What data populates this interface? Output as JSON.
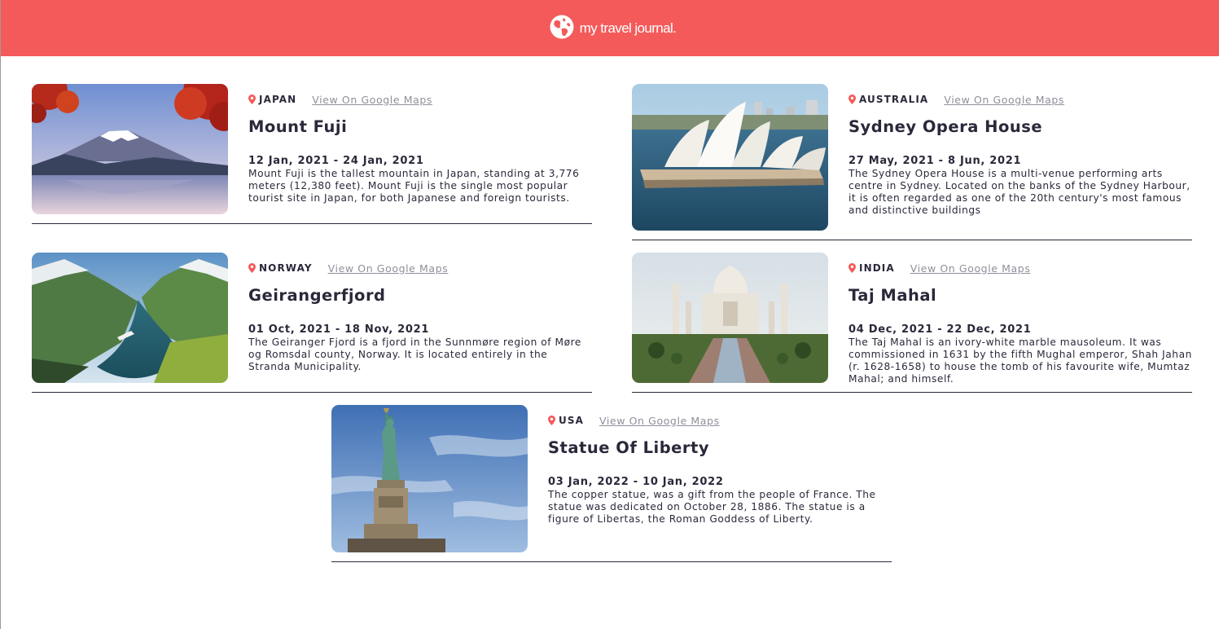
{
  "header": {
    "title": "my travel journal."
  },
  "entries": [
    {
      "country": "JAPAN",
      "maps_label": "View On Google Maps",
      "title": "Mount Fuji",
      "dates": "12 Jan, 2021 - 24 Jan, 2021",
      "description": "Mount Fuji is the tallest mountain in Japan, standing at 3,776 meters (12,380 feet). Mount Fuji is the single most popular tourist site in Japan, for both Japanese and foreign tourists.",
      "photo": "mount-fuji-photo"
    },
    {
      "country": "AUSTRALIA",
      "maps_label": "View On Google Maps",
      "title": "Sydney Opera House",
      "dates": "27 May, 2021 - 8 Jun, 2021",
      "description": "The Sydney Opera House is a multi-venue performing arts centre in Sydney. Located on the banks of the Sydney Harbour, it is often regarded as one of the 20th century's most famous and distinctive buildings",
      "photo": "sydney-opera-house-photo"
    },
    {
      "country": "NORWAY",
      "maps_label": "View On Google Maps",
      "title": "Geirangerfjord",
      "dates": "01 Oct, 2021 - 18 Nov, 2021",
      "description": "The Geiranger Fjord is a fjord in the Sunnmøre region of Møre og Romsdal county, Norway. It is located entirely in the Stranda Municipality.",
      "photo": "geirangerfjord-photo"
    },
    {
      "country": "INDIA",
      "maps_label": "View On Google Maps",
      "title": "Taj Mahal",
      "dates": "04 Dec, 2021 - 22 Dec, 2021",
      "description": "The Taj Mahal is an ivory-white marble mausoleum. It was commissioned in 1631 by the fifth Mughal emperor, Shah Jahan (r. 1628-1658) to house the tomb of his favourite wife, Mumtaz Mahal; and himself.",
      "photo": "taj-mahal-photo"
    },
    {
      "country": "USA",
      "maps_label": "View On Google Maps",
      "title": "Statue Of Liberty",
      "dates": "03 Jan, 2022 - 10 Jan, 2022",
      "description": "The copper statue, was a gift from the people of France. The statue was dedicated on October 28, 1886. The statue is a figure of Libertas, the Roman Goddess of Liberty.",
      "photo": "statue-of-liberty-photo"
    }
  ],
  "colors": {
    "brand": "#f55a5a",
    "text": "#2b283a",
    "link": "#918e9b"
  },
  "icons": {
    "logo": "globe-icon",
    "location": "location-pin-icon"
  }
}
